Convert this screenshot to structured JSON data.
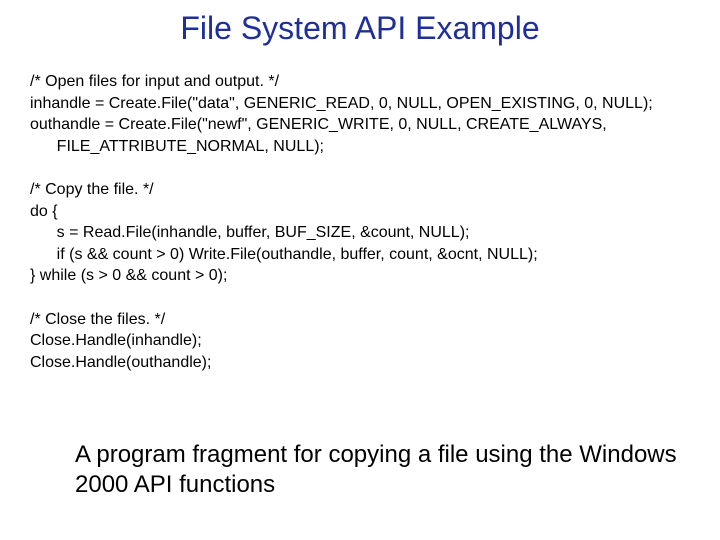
{
  "title": "File System API Example",
  "code": "/* Open files for input and output. */\ninhandle = Create.File(\"data\", GENERIC_READ, 0, NULL, OPEN_EXISTING, 0, NULL);\nouthandle = Create.File(\"newf\", GENERIC_WRITE, 0, NULL, CREATE_ALWAYS,\n      FILE_ATTRIBUTE_NORMAL, NULL);\n\n/* Copy the file. */\ndo {\n      s = Read.File(inhandle, buffer, BUF_SIZE, &count, NULL);\n      if (s && count > 0) Write.File(outhandle, buffer, count, &ocnt, NULL);\n} while (s > 0 && count > 0);\n\n/* Close the files. */\nClose.Handle(inhandle);\nClose.Handle(outhandle);",
  "caption": "A program fragment for copying a file using the Windows 2000 API functions"
}
